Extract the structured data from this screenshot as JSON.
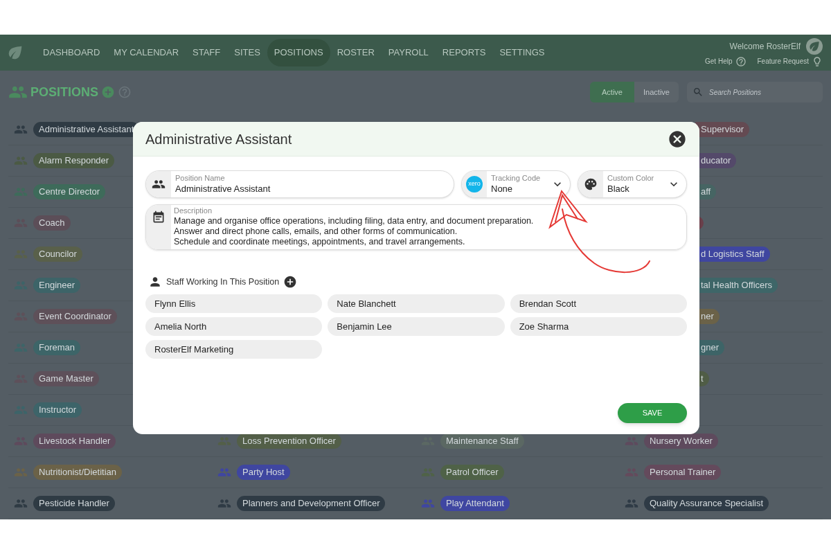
{
  "nav": {
    "items": [
      {
        "label": "DASHBOARD",
        "selected": false
      },
      {
        "label": "MY CALENDAR",
        "selected": false
      },
      {
        "label": "STAFF",
        "selected": false
      },
      {
        "label": "SITES",
        "selected": false
      },
      {
        "label": "POSITIONS",
        "selected": true
      },
      {
        "label": "ROSTER",
        "selected": false
      },
      {
        "label": "PAYROLL",
        "selected": false
      },
      {
        "label": "REPORTS",
        "selected": false
      },
      {
        "label": "SETTINGS",
        "selected": false
      }
    ],
    "welcome": "Welcome RosterElf",
    "help": "Get Help",
    "feature": "Feature Request"
  },
  "header": {
    "title": "POSITIONS",
    "filters": [
      {
        "label": "Active",
        "selected": true
      },
      {
        "label": "Inactive",
        "selected": false
      }
    ],
    "search": {
      "placeholder": "Search Positions"
    }
  },
  "upper_rows": [
    {
      "left": {
        "name": "Administrative Assistant",
        "color": "#2f3b44"
      },
      "right": {
        "name": "Supervisor",
        "color": "#644a52"
      }
    },
    {
      "left": {
        "name": "Alarm Responder",
        "color": "#4b5a44"
      },
      "right": {
        "name": "ducator",
        "color": "#54496a"
      }
    },
    {
      "left": {
        "name": "Centre Director",
        "color": "#3e6b5a"
      },
      "right": {
        "name": "aff",
        "color": "#466563"
      }
    },
    {
      "left": {
        "name": "Coach",
        "color": "#5c4e58"
      },
      "right": {
        "color": "#6a3f4a"
      }
    },
    {
      "left": {
        "name": "Councilor",
        "color": "#59604a"
      },
      "right": {
        "name": "d Logistics Staff",
        "color": "#3f46a0"
      }
    },
    {
      "left": {
        "name": "Engineer",
        "color": "#3d6468"
      },
      "right": {
        "name": "tal Health Officers",
        "color": "#3e6668"
      }
    },
    {
      "left": {
        "name": "Event Coordinator",
        "color": "#5e5059"
      },
      "right": {
        "name": "ner",
        "color": "#6b6248"
      }
    },
    {
      "left": {
        "name": "Foreman",
        "color": "#3d6568"
      },
      "right": {
        "name": "gner",
        "color": "#3d6467"
      }
    },
    {
      "left": {
        "name": "Game Master",
        "color": "#5e505a"
      },
      "right": {
        "name": "t",
        "color": "#505d46"
      }
    },
    {
      "left": {
        "name": "Instructor",
        "color": "#3d6469"
      }
    }
  ],
  "lower_rows": [
    [
      {
        "name": "Livestock Handler",
        "color": "#5e4a5c"
      },
      {
        "name": "Loss Prevention Officer",
        "color": "#535f48"
      },
      {
        "name": "Maintenance Staff",
        "color": "#5b6863"
      },
      {
        "name": "Nursery Worker",
        "color": "#5e4a5d"
      }
    ],
    [
      {
        "name": "Nutritionist/Dietitian",
        "color": "#6b6248"
      },
      {
        "name": "Party Host",
        "color": "#3f46a0"
      },
      {
        "name": "Patrol Officer",
        "color": "#4f6247"
      },
      {
        "name": "Personal Trainer",
        "color": "#644a5c"
      }
    ],
    [
      {
        "name": "Pesticide Handler",
        "color": "#2f3b44"
      },
      {
        "name": "Planners and Development Officer",
        "color": "#2f3b45"
      },
      {
        "name": "Play Attendant",
        "color": "#3f46a1"
      },
      {
        "name": "Quality Assurance Specialist",
        "color": "#2f3b46"
      }
    ]
  ],
  "modal": {
    "title": "Administrative Assistant",
    "fields": [
      {
        "kind": "text",
        "label": "Position Name",
        "value": "Administrative Assistant"
      },
      {
        "kind": "tracking",
        "label": "Tracking Code",
        "value": "None",
        "logo_text": "xero"
      },
      {
        "kind": "color",
        "label": "Custom Color",
        "value": "Black"
      }
    ],
    "description": {
      "label": "Description",
      "lines": [
        "Manage and organise office operations, including filing, data entry, and document preparation.",
        "Answer and direct phone calls, emails, and other forms of communication.",
        "Schedule and coordinate meetings, appointments, and travel arrangements."
      ]
    },
    "staff": {
      "heading": "Staff Working In This Position",
      "members": [
        "Flynn Ellis",
        "Nate Blanchett",
        "Brendan Scott",
        "Amelia North",
        "Benjamin Lee",
        "Zoe Sharma",
        "RosterElf Marketing"
      ]
    },
    "save": "SAVE"
  }
}
